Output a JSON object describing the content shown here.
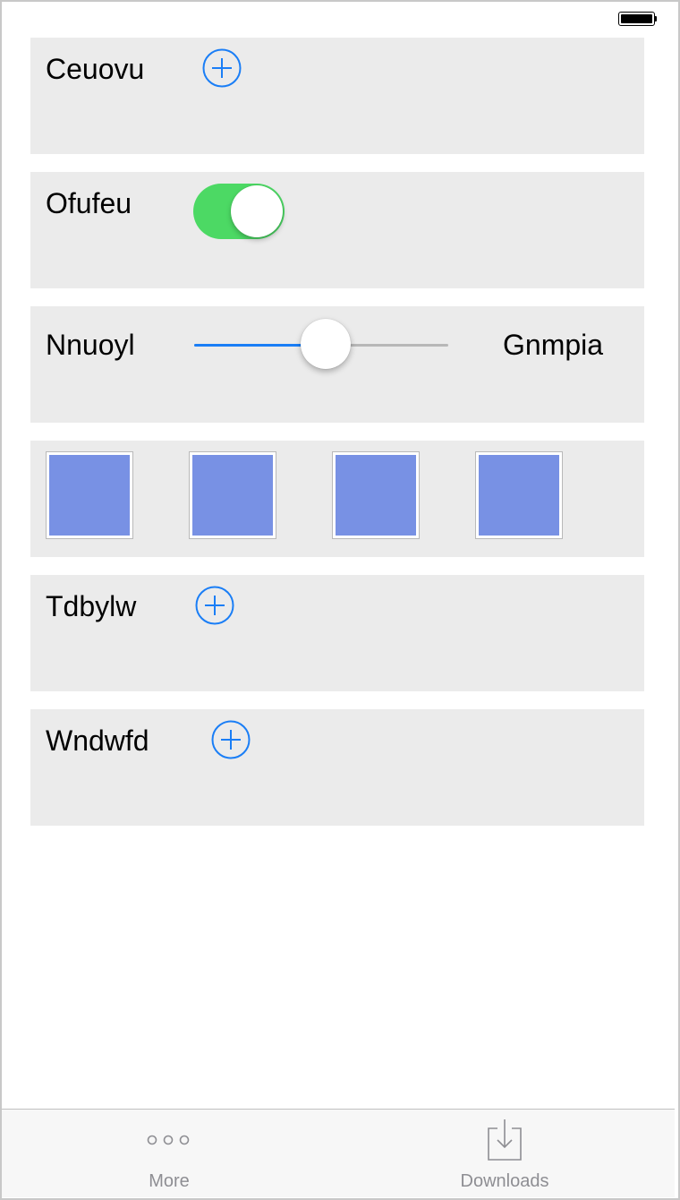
{
  "status_bar": {
    "battery_icon": "battery-full-icon"
  },
  "rows": {
    "row1": {
      "label": "Ceuovu",
      "icon": "plus-circle-icon"
    },
    "row2": {
      "label": "Ofufeu",
      "toggle_on": true,
      "toggle_color": "#4cd964"
    },
    "row3": {
      "label": "Nnuoyl",
      "end_label": "Gnmpia",
      "slider_value": 0.5,
      "accent": "#1a7ef6"
    },
    "row4": {
      "swatch_color": "#7891e4",
      "swatch_count": 4
    },
    "row5": {
      "label": "Tdbylw",
      "icon": "plus-circle-icon"
    },
    "row6": {
      "label": "Wndwfd",
      "icon": "plus-circle-icon"
    }
  },
  "tab_bar": {
    "tabs": [
      {
        "label": "More",
        "icon": "more-dots-icon"
      },
      {
        "label": "Downloads",
        "icon": "download-tray-icon"
      }
    ]
  }
}
